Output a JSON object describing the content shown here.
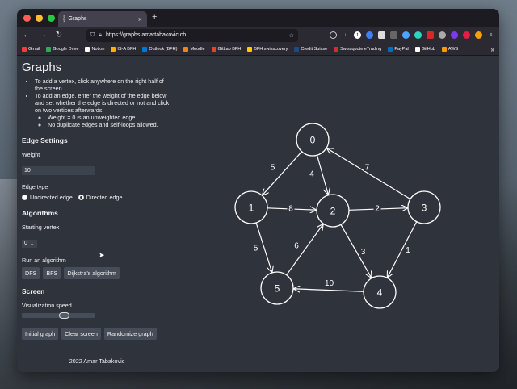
{
  "browser": {
    "tab_title": "Graphs",
    "url": "https://graphs.amartabakovic.ch",
    "bookmarks": [
      {
        "label": "Gmail",
        "color": "#ea4335"
      },
      {
        "label": "Google Drive",
        "color": "#34a853"
      },
      {
        "label": "Notion",
        "color": "#ffffff"
      },
      {
        "label": "IS-A BFH",
        "color": "#f4b400"
      },
      {
        "label": "Outlook (BFH)",
        "color": "#0078d4"
      },
      {
        "label": "Moodle",
        "color": "#f98012"
      },
      {
        "label": "GitLab BFH",
        "color": "#e24329"
      },
      {
        "label": "BFH swisscovery",
        "color": "#ffcc00"
      },
      {
        "label": "Credit Suisse",
        "color": "#1a4b8c"
      },
      {
        "label": "Swissquote eTrading",
        "color": "#d62b2b"
      },
      {
        "label": "PayPal",
        "color": "#0070ba"
      },
      {
        "label": "GitHub",
        "color": "#ffffff"
      },
      {
        "label": "AWS",
        "color": "#ff9900"
      }
    ]
  },
  "sidebar": {
    "title": "Graphs",
    "instructions": [
      "To add a vertex, click anywhere on the right half of the screen.",
      "To add an edge, enter the weight of the edge below and set whether the edge is directed or not and click on two vertices afterwards."
    ],
    "sub_instructions": [
      "Weight = 0 is an unweighted edge.",
      "No duplicate edges and self-loops allowed."
    ],
    "edge_settings": {
      "heading": "Edge Settings",
      "weight_label": "Weight",
      "weight_value": "10",
      "edge_type_label": "Edge type",
      "undirected_label": "Undirected edge",
      "directed_label": "Directed edge",
      "selected": "directed"
    },
    "algorithms": {
      "heading": "Algorithms",
      "starting_vertex_label": "Starting vertex",
      "starting_vertex_value": "0",
      "run_label": "Run an algorithm",
      "buttons": [
        "DFS",
        "BFS",
        "Dijkstra's algorithm"
      ]
    },
    "screen": {
      "heading": "Screen",
      "speed_label": "Visualization speed",
      "speed_value": 0.55,
      "buttons": [
        "Initial graph",
        "Clear screen",
        "Randomize graph"
      ]
    },
    "footer": "2022 Amar Tabakovic"
  },
  "graph": {
    "vertices": [
      {
        "id": "0",
        "label": "0"
      },
      {
        "id": "1",
        "label": "1"
      },
      {
        "id": "2",
        "label": "2"
      },
      {
        "id": "3",
        "label": "3"
      },
      {
        "id": "4",
        "label": "4"
      },
      {
        "id": "5",
        "label": "5"
      }
    ],
    "edges": [
      {
        "from": "0",
        "to": "1",
        "weight": "5"
      },
      {
        "from": "0",
        "to": "2",
        "weight": "4"
      },
      {
        "from": "3",
        "to": "0",
        "weight": "7"
      },
      {
        "from": "1",
        "to": "2",
        "weight": "8"
      },
      {
        "from": "2",
        "to": "3",
        "weight": "2"
      },
      {
        "from": "1",
        "to": "5",
        "weight": "5"
      },
      {
        "from": "5",
        "to": "2",
        "weight": "6"
      },
      {
        "from": "2",
        "to": "4",
        "weight": "3"
      },
      {
        "from": "3",
        "to": "4",
        "weight": "1"
      },
      {
        "from": "4",
        "to": "5",
        "weight": "10"
      }
    ],
    "colors": {
      "stroke": "#ffffff",
      "fill": "#2e333c"
    }
  }
}
